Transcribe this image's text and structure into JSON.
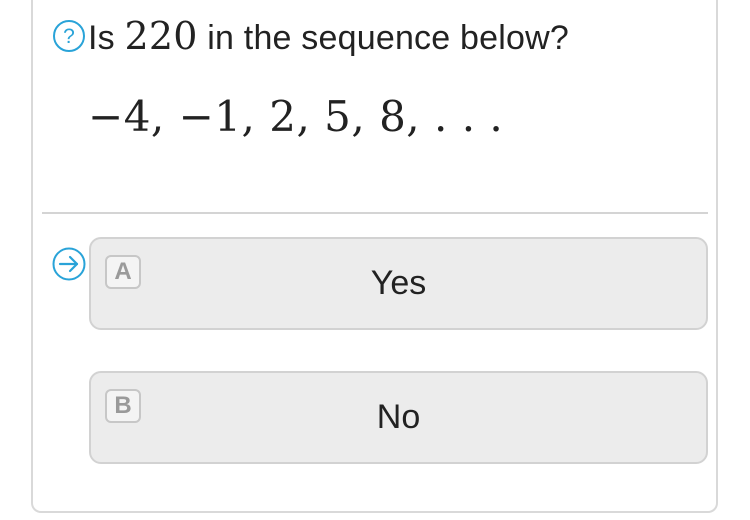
{
  "question": {
    "prefix": "Is ",
    "number": "220",
    "suffix": " in the sequence below?",
    "help_icon": "question-circle-icon"
  },
  "sequence": {
    "text": "−4, −1, 2, 5, 8, . . ."
  },
  "choices": [
    {
      "letter": "A",
      "label": "Yes"
    },
    {
      "letter": "B",
      "label": "No"
    }
  ],
  "colors": {
    "accent": "#29a3d8",
    "choice_bg": "#ececec",
    "choice_border": "#d2d2d2",
    "text": "#222222"
  }
}
